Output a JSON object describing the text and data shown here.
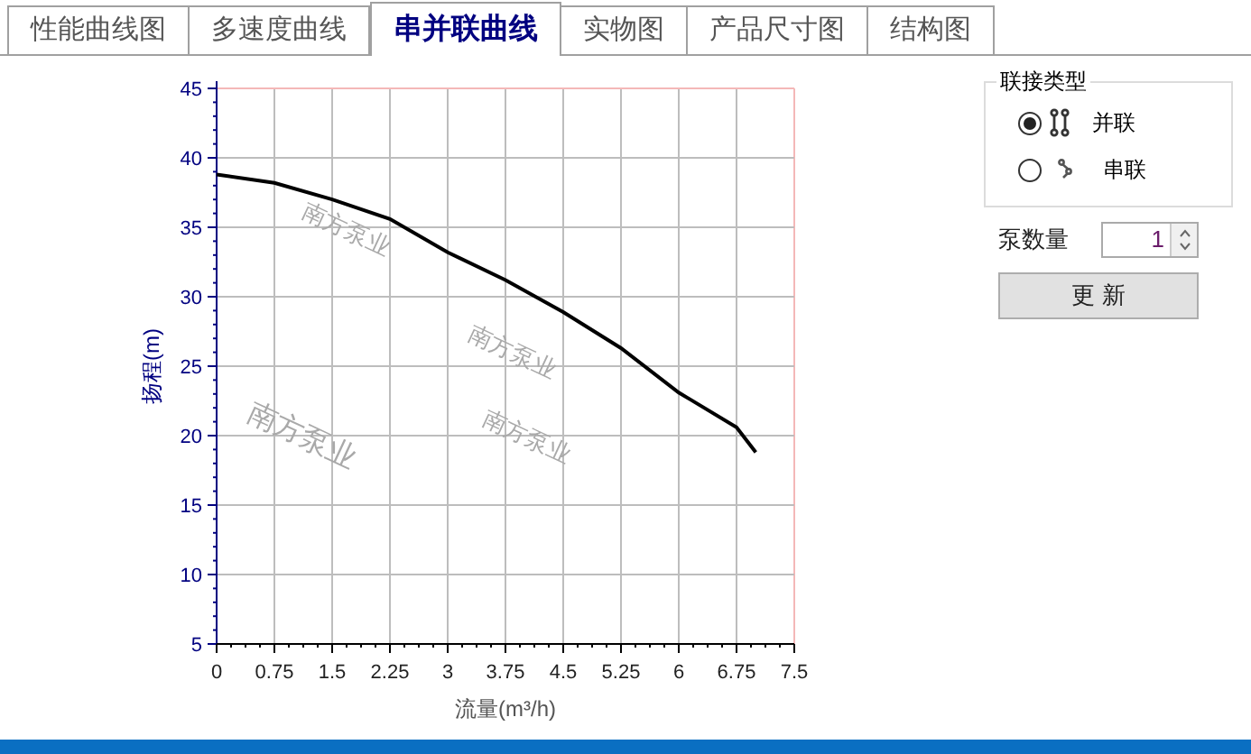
{
  "tabs": [
    {
      "label": "性能曲线图",
      "selected": false
    },
    {
      "label": "多速度曲线",
      "selected": false
    },
    {
      "label": "串并联曲线",
      "selected": true
    },
    {
      "label": "实物图",
      "selected": false
    },
    {
      "label": "产品尺寸图",
      "selected": false
    },
    {
      "label": "结构图",
      "selected": false
    }
  ],
  "chart": {
    "chart_data": {
      "type": "line",
      "xlabel": "流量(m³/h)",
      "ylabel": "扬程(m)",
      "x": [
        0,
        0.75,
        1.5,
        2.25,
        3,
        3.75,
        4.5,
        5.25,
        6,
        6.75,
        7
      ],
      "series": [
        {
          "color": "#000000",
          "values": [
            38.8,
            38.2,
            37,
            35.6,
            33.2,
            31.2,
            28.9,
            26.3,
            23.1,
            20.6,
            18.8
          ]
        }
      ],
      "xlim": [
        0,
        7.5
      ],
      "ylim": [
        5,
        45
      ],
      "xticks": [
        0,
        0.75,
        1.5,
        2.25,
        3,
        3.75,
        4.5,
        5.25,
        6,
        6.75,
        7.5
      ],
      "yticks": [
        5,
        10,
        15,
        20,
        25,
        30,
        35,
        40,
        45
      ],
      "grid": true
    },
    "watermarks": [
      "南方泵业",
      "南方泵业",
      "南方泵业",
      "南方泵业"
    ]
  },
  "connection": {
    "title": "联接类型",
    "options": [
      {
        "label": "并联",
        "kind": "parallel",
        "selected": true
      },
      {
        "label": "串联",
        "kind": "series",
        "selected": false
      }
    ]
  },
  "pump_count": {
    "label": "泵数量",
    "value": "1"
  },
  "update_button": "更 新"
}
